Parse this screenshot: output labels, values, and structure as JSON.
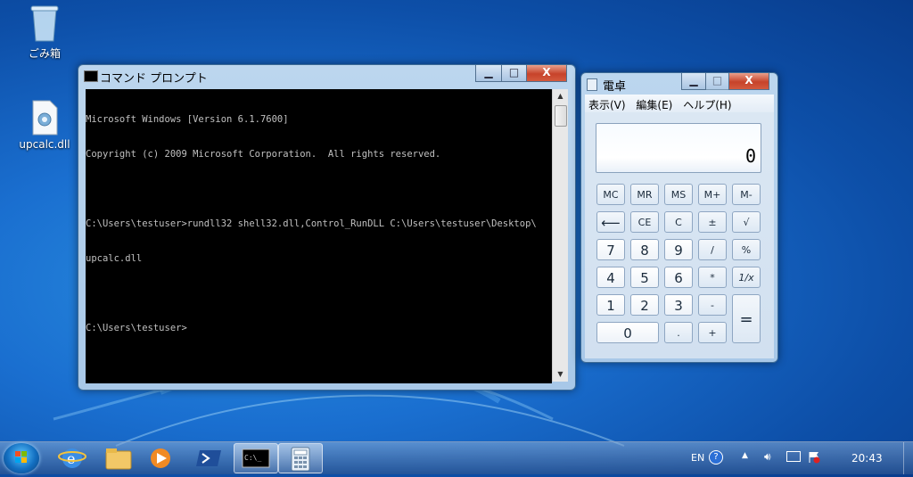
{
  "desktop": {
    "icons": [
      {
        "label": "ごみ箱"
      },
      {
        "label": "upcalc.dll"
      }
    ]
  },
  "cmd": {
    "title": "コマンド プロンプト",
    "lines": [
      "Microsoft Windows [Version 6.1.7600]",
      "Copyright (c) 2009 Microsoft Corporation.  All rights reserved.",
      "",
      "C:\\Users\\testuser>rundll32 shell32.dll,Control_RunDLL C:\\Users\\testuser\\Desktop\\",
      "upcalc.dll",
      "",
      "C:\\Users\\testuser>"
    ]
  },
  "calc": {
    "title": "電卓",
    "menu": [
      "表示(V)",
      "編集(E)",
      "ヘルプ(H)"
    ],
    "display": "0",
    "keys": {
      "mc": "MC",
      "mr": "MR",
      "ms": "MS",
      "mplus": "M+",
      "mminus": "M-",
      "back": "⟵",
      "ce": "CE",
      "c": "C",
      "pm": "±",
      "sqrt": "√",
      "k7": "7",
      "k8": "8",
      "k9": "9",
      "div": "/",
      "pct": "%",
      "k4": "4",
      "k5": "5",
      "k6": "6",
      "mul": "*",
      "inv": "1/x",
      "k1": "1",
      "k2": "2",
      "k3": "3",
      "sub": "-",
      "eq": "=",
      "k0": "0",
      "dot": ".",
      "add": "+"
    }
  },
  "taskbar": {
    "lang": "EN",
    "clock": "20:43"
  },
  "window_controls": {
    "minimize": "▁",
    "maximize": "□",
    "close": "X"
  },
  "icons": [
    "recycle-bin-icon",
    "dll-file-icon",
    "cmd-icon",
    "calc-icon",
    "start-orb-icon",
    "ie-icon",
    "explorer-icon",
    "media-player-icon",
    "powershell-icon",
    "help-icon",
    "flag-icon",
    "volume-icon",
    "network-icon"
  ]
}
